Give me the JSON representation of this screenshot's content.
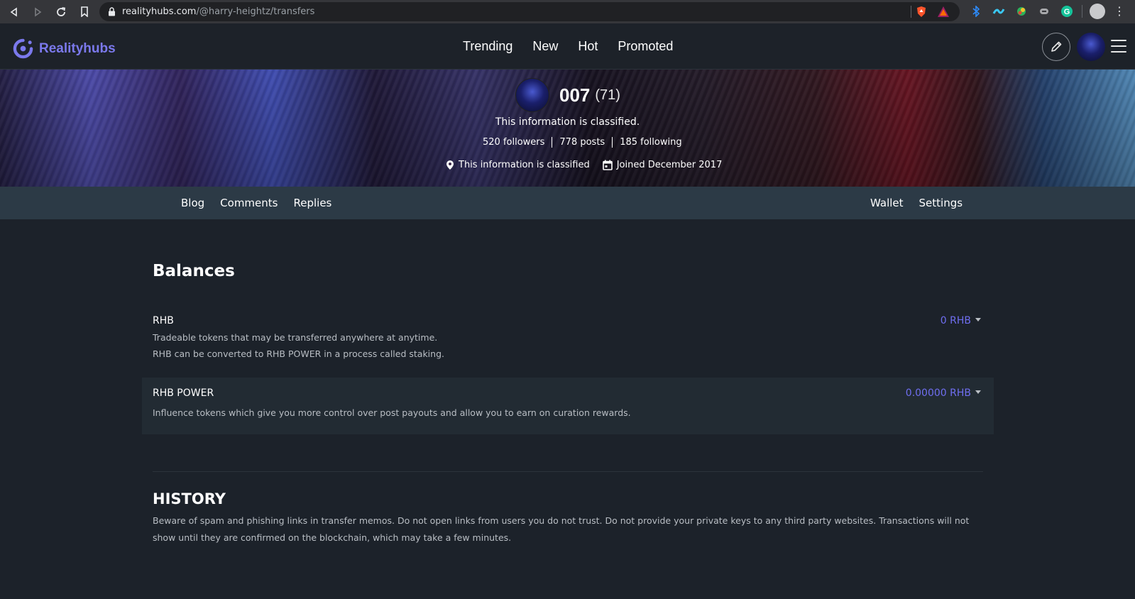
{
  "browser": {
    "url_host": "realityhubs.com",
    "url_path": "/@harry-heightz/transfers"
  },
  "header": {
    "brand": "Realityhubs",
    "nav": [
      "Trending",
      "New",
      "Hot",
      "Promoted"
    ]
  },
  "profile": {
    "name": "007",
    "reputation": "(71)",
    "about": "This information is classified.",
    "stats": [
      "520 followers",
      "778 posts",
      "185 following"
    ],
    "location": "This information is classified",
    "joined": "Joined December 2017"
  },
  "subnav": {
    "left": [
      "Blog",
      "Comments",
      "Replies"
    ],
    "right": [
      "Wallet",
      "Settings"
    ]
  },
  "balances": {
    "heading": "Balances",
    "rhb": {
      "label": "RHB",
      "desc_line1": "Tradeable tokens that may be transferred anywhere at anytime.",
      "desc_line2": "RHB can be converted to RHB POWER in a process called staking.",
      "amount": "0 RHB"
    },
    "power": {
      "label": "RHB POWER",
      "desc": "Influence tokens which give you more control over post payouts and allow you to earn on curation rewards.",
      "amount": "0.00000 RHB"
    }
  },
  "history": {
    "heading": "HISTORY",
    "note": "Beware of spam and phishing links in transfer memos. Do not open links from users you do not trust. Do not provide your private keys to any third party websites. Transactions will not show until they are confirmed on the blockchain, which may take a few minutes."
  },
  "colors": {
    "accent": "#6f6ef0",
    "brand": "#7b79ec",
    "background": "#1c222a",
    "subnav": "#2c3a46"
  },
  "icons": [
    "back-icon",
    "forward-icon",
    "reload-icon",
    "bookmark-icon",
    "lock-icon",
    "pencil-icon",
    "location-icon",
    "calendar-icon",
    "hamburger-icon"
  ]
}
